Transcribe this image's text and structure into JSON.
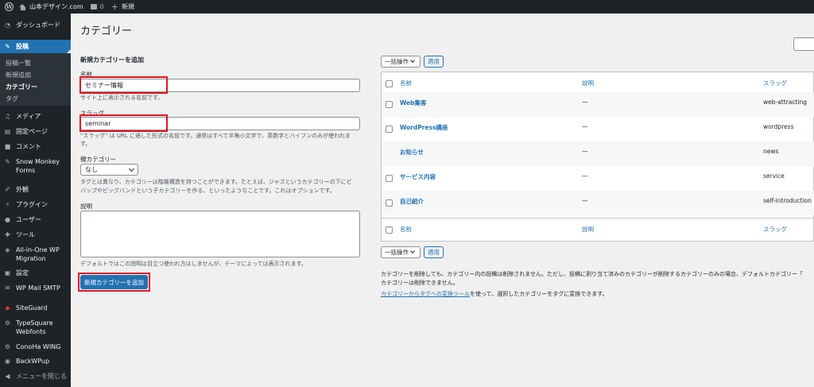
{
  "adminbar": {
    "wp_icon": "wordpress-logo-icon",
    "site_name": "山本デザイン.com",
    "comment_count": "0",
    "new_label": "新規"
  },
  "sidebar": {
    "dashboard": "ダッシュボード",
    "posts": "投稿",
    "posts_sub": [
      "投稿一覧",
      "新規追加",
      "カテゴリー",
      "タグ"
    ],
    "media": "メディア",
    "pages": "固定ページ",
    "comments": "コメント",
    "snow_monkey_forms": "Snow Monkey Forms",
    "appearance": "外観",
    "plugins": "プラグイン",
    "users": "ユーザー",
    "tools": "ツール",
    "all_in_one": "All-in-One WP Migration",
    "settings": "設定",
    "wp_mail_smtp": "WP Mail SMTP",
    "siteguard": "SiteGuard",
    "typesquare": "TypeSquare Webfonts",
    "conoha": "ConoHa WING",
    "backwpup": "BackWPup",
    "collapse": "メニューを閉じる"
  },
  "page": {
    "title": "カテゴリー"
  },
  "form": {
    "heading": "新規カテゴリーを追加",
    "name_label": "名前",
    "name_value": "セミナー情報",
    "name_desc": "サイト上に表示される名前です。",
    "slug_label": "スラッグ",
    "slug_value": "seminar",
    "slug_desc": "\"スラッグ\" は URL に適した形式の名前です。通常はすべて半角小文字で、英数字とハイフンのみが使われます。",
    "parent_label": "親カテゴリー",
    "parent_value": "なし",
    "parent_desc_1": "タグとは異なり、カテゴリーは階層構造を持つことができます。たとえば、ジャズというカテゴリーの下にビ",
    "parent_desc_2": "バップやビッグバンドという子カテゴリーを作る、といったようなことです。これはオプションです。",
    "description_label": "説明",
    "description_desc": "デフォルトではこの説明は目立つ使われ方はしませんが、テーマによっては表示されます。",
    "submit_label": "新規カテゴリーを追加"
  },
  "list": {
    "bulk_label": "一括操作",
    "apply_label": "適用",
    "columns": {
      "name": "名前",
      "description": "説明",
      "slug": "スラッグ"
    },
    "rows": [
      {
        "name": "Web集客",
        "description": "—",
        "slug": "web-attracting",
        "checkbox": true
      },
      {
        "name": "WordPress講座",
        "description": "—",
        "slug": "wordpress",
        "checkbox": true
      },
      {
        "name": "お知らせ",
        "description": "—",
        "slug": "news",
        "checkbox": false
      },
      {
        "name": "サービス内容",
        "description": "—",
        "slug": "service",
        "checkbox": true
      },
      {
        "name": "自己紹介",
        "description": "—",
        "slug": "self-introduction",
        "checkbox": true
      }
    ],
    "note_1": "カテゴリーを削除しても、カテゴリー内の投稿は削除されません。ただし、投稿に割り当て済みのカテゴリーが削除するカテゴリーのみの場合、デフォルトカテゴリー「",
    "note_2": "カテゴリーは削除できません。",
    "note_link": "カテゴリーからタグへの変換ツール",
    "note_3": "を使って、選択したカテゴリーをタグに変換できます。"
  },
  "colors": {
    "accent": "#2271b1",
    "sidebar": "#1d2327",
    "highlight": "#e0141e"
  }
}
